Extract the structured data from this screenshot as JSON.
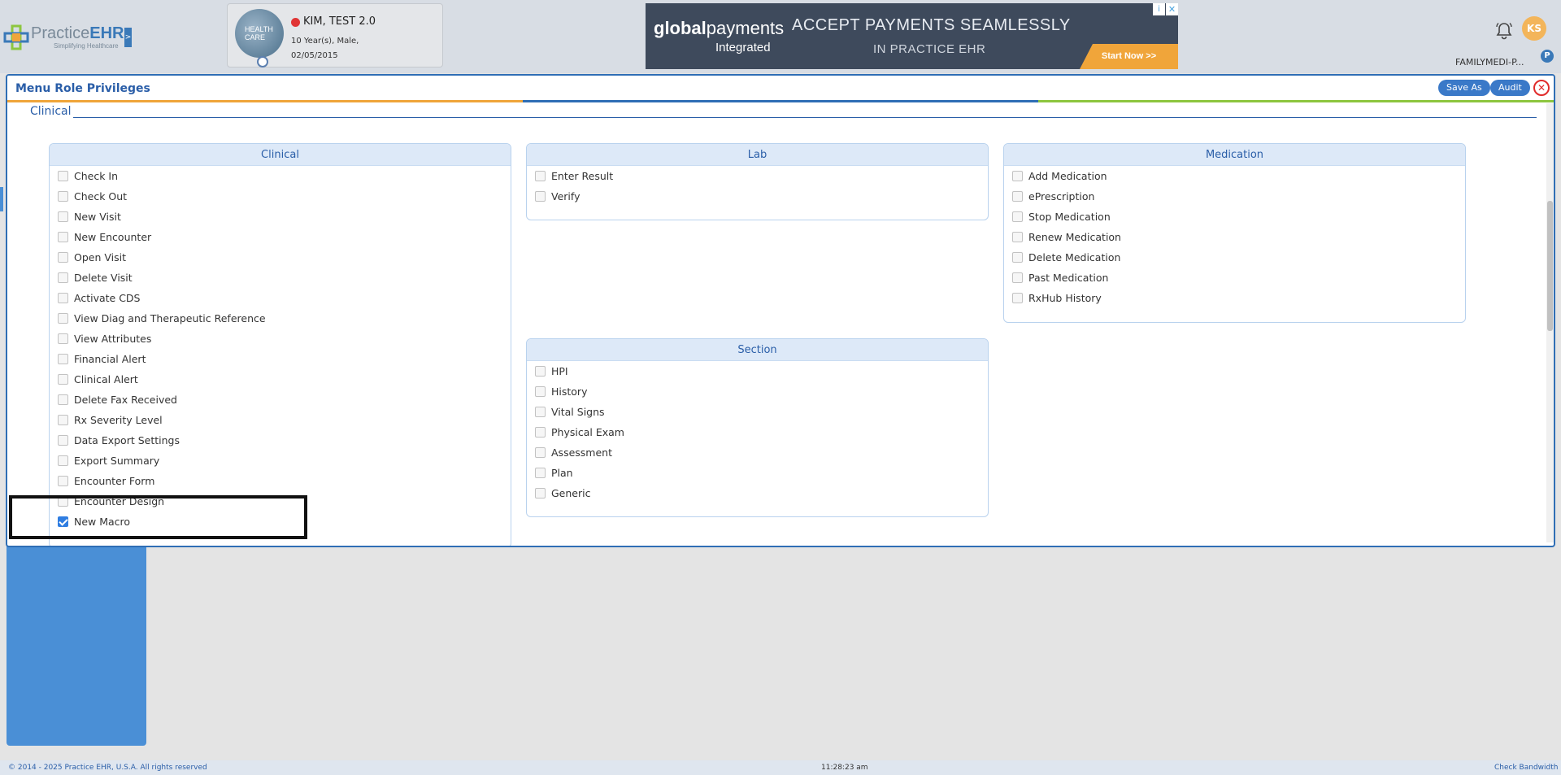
{
  "app": {
    "logo_name_light": "Practice",
    "logo_name_bold": "EHR",
    "logo_tagline": "Simplifying Healthcare",
    "logo_expand": ">"
  },
  "patient": {
    "photo_text": "HEALTH CARE",
    "name": "KIM, TEST 2.0",
    "age_sex": "10 Year(s), Male,",
    "dob": "02/05/2015"
  },
  "ad": {
    "brand_bold": "global",
    "brand_light": "payments",
    "brand_sub": "Integrated",
    "headline": "ACCEPT PAYMENTS SEAMLESSLY",
    "subheadline": "IN PRACTICE EHR",
    "cta": "Start Now >>",
    "info_glyph": "i",
    "close_glyph": "✕"
  },
  "user": {
    "initials": "KS",
    "practice": "FAMILYMEDI-P...",
    "pin": "P"
  },
  "modal": {
    "title": "Menu Role Privileges",
    "save_as": "Save As",
    "audit": "Audit",
    "close_glyph": "✕",
    "section_legend": "Clinical"
  },
  "groups": {
    "clinical": {
      "title": "Clinical",
      "items": [
        {
          "label": "Check In",
          "checked": false
        },
        {
          "label": "Check Out",
          "checked": false
        },
        {
          "label": "New Visit",
          "checked": false
        },
        {
          "label": "New Encounter",
          "checked": false
        },
        {
          "label": "Open Visit",
          "checked": false
        },
        {
          "label": "Delete Visit",
          "checked": false
        },
        {
          "label": "Activate CDS",
          "checked": false
        },
        {
          "label": "View Diag and Therapeutic Reference",
          "checked": false
        },
        {
          "label": "View Attributes",
          "checked": false
        },
        {
          "label": "Financial Alert",
          "checked": false
        },
        {
          "label": "Clinical Alert",
          "checked": false
        },
        {
          "label": "Delete Fax Received",
          "checked": false
        },
        {
          "label": "Rx Severity Level",
          "checked": false
        },
        {
          "label": "Data Export Settings",
          "checked": false
        },
        {
          "label": "Export Summary",
          "checked": false
        },
        {
          "label": "Encounter Form",
          "checked": false
        },
        {
          "label": "Encounter Design",
          "checked": false
        },
        {
          "label": "New Macro",
          "checked": true
        }
      ]
    },
    "lab": {
      "title": "Lab",
      "items": [
        {
          "label": "Enter Result",
          "checked": false
        },
        {
          "label": "Verify",
          "checked": false
        }
      ]
    },
    "section": {
      "title": "Section",
      "items": [
        {
          "label": "HPI",
          "checked": false
        },
        {
          "label": "History",
          "checked": false
        },
        {
          "label": "Vital Signs",
          "checked": false
        },
        {
          "label": "Physical Exam",
          "checked": false
        },
        {
          "label": "Assessment",
          "checked": false
        },
        {
          "label": "Plan",
          "checked": false
        },
        {
          "label": "Generic",
          "checked": false
        }
      ]
    },
    "medication": {
      "title": "Medication",
      "items": [
        {
          "label": "Add Medication",
          "checked": false
        },
        {
          "label": "ePrescription",
          "checked": false
        },
        {
          "label": "Stop Medication",
          "checked": false
        },
        {
          "label": "Renew Medication",
          "checked": false
        },
        {
          "label": "Delete Medication",
          "checked": false
        },
        {
          "label": "Past Medication",
          "checked": false
        },
        {
          "label": "RxHub History",
          "checked": false
        }
      ]
    }
  },
  "footer": {
    "copyright": "© 2014 - 2025 Practice EHR, U.S.A. All rights reserved",
    "time": "11:28:23 am",
    "bandwidth": "Check Bandwidth"
  },
  "colors": {
    "primary": "#2a5ea8",
    "accent_orange": "#f0a53a",
    "accent_blue": "#2f6eb5",
    "accent_green": "#8dc63f",
    "close_red": "#e02b2b"
  }
}
